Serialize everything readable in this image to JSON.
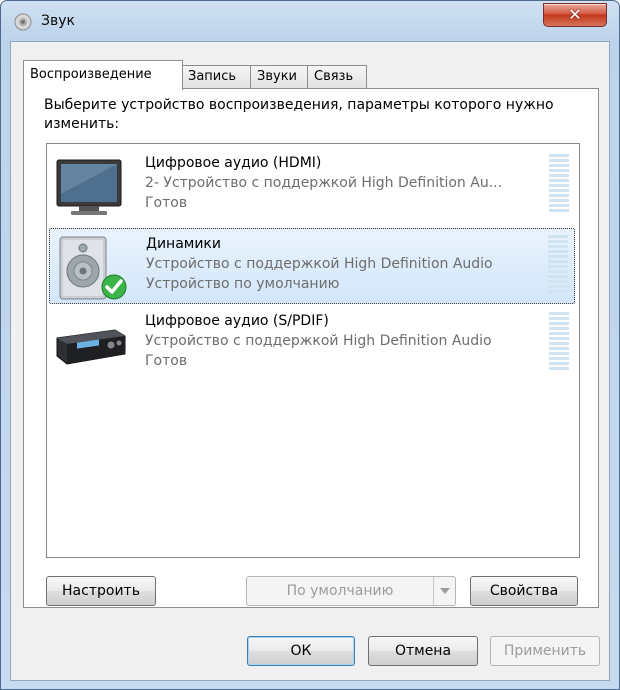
{
  "window": {
    "title": "Звук"
  },
  "tabs": [
    {
      "label": "Воспроизведение",
      "active": true
    },
    {
      "label": "Запись",
      "active": false
    },
    {
      "label": "Звуки",
      "active": false
    },
    {
      "label": "Связь",
      "active": false
    }
  ],
  "playback": {
    "instruction": "Выберите устройство воспроизведения, параметры которого нужно изменить:",
    "devices": [
      {
        "name": "Цифровое аудио (HDMI)",
        "description": "2- Устройство с поддержкой High Definition Au...",
        "status": "Готов",
        "icon": "monitor-icon",
        "selected": false
      },
      {
        "name": "Динамики",
        "description": "Устройство с поддержкой High Definition Audio",
        "status": "Устройство по умолчанию",
        "icon": "speaker-icon",
        "selected": true,
        "default_badge": "check-icon"
      },
      {
        "name": "Цифровое аудио (S/PDIF)",
        "description": "Устройство с поддержкой High Definition Audio",
        "status": "Готов",
        "icon": "receiver-icon",
        "selected": false
      }
    ],
    "configure_label": "Настроить",
    "set_default_label": "По умолчанию",
    "properties_label": "Свойства"
  },
  "footer": {
    "ok_label": "ОК",
    "cancel_label": "Отмена",
    "apply_label": "Применить"
  },
  "colors": {
    "selection": "#d3e6fa",
    "meter": "#cfe3f1",
    "check": "#3bb44a"
  }
}
